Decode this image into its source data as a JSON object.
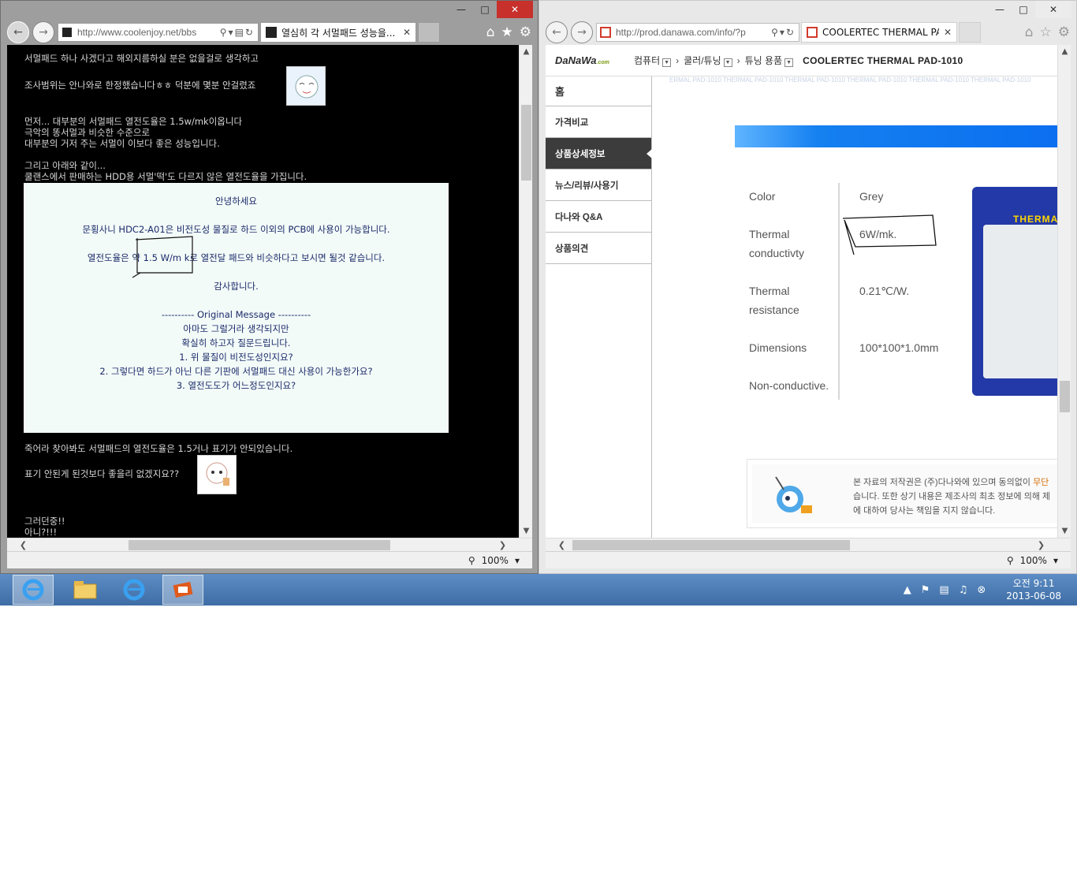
{
  "left_window": {
    "url": "http://www.coolenjoy.net/bbs",
    "tab_title": "열심히 각 서멀패드 성능을...",
    "zoom": "100%",
    "lines_top": [
      "서멀패드 하나 사겠다고 해외지름하실 분은 없을걸로 생각하고",
      "조사범위는 안나와로 한정했습니다ㅎㅎ 덕분에 몇분 안걸렸죠",
      "먼저... 대부분의 서멀패드 열전도율은 1.5w/mk이옵니다",
      "극악의 똥서멀과 비슷한 수준으로",
      "대부분의 거저 주는 서멀이 이보다 좋은 성능입니다.",
      "그리고 아래와 같이...",
      "쿨랜스에서 판매하는 HDD용 서멀'떡'도 다르지 않은 열전도율을 가집니다."
    ],
    "letter": [
      "안녕하세요",
      "문횡사니 HDC2-A01은 비전도성 물질로 하드 이외의 PCB에 사용이 가능합니다.",
      "열전도율은 약 1.5 W/m k로 열전달 패드와 비슷하다고 보시면 될것 같습니다.",
      "감사합니다.",
      "---------- Original Message ----------",
      "아마도 그럴거라 생각되지만",
      "확실히 하고자 질문드립니다.",
      "1. 위 물질이 비전도성인지요?",
      "2. 그렇다면 하드가 아닌 다른 기판에 서멀패드 대신 사용이 가능한가요?",
      "3. 열전도도가 어느정도인지요?"
    ],
    "lines_bottom": [
      "죽어라 찾아봐도 서멀패드의 열전도율은 1.5거나 표기가 안되있습니다.",
      "표기 안된게 된것보다 좋을리 없겠지요??",
      "그러던중!!",
      "아니?!!!"
    ]
  },
  "right_window": {
    "url": "http://prod.danawa.com/info/?p",
    "tab_title": "COOLERTEC THERMAL PA...",
    "zoom": "100%",
    "logo": "DaNaWa",
    "logo_suffix": ".com",
    "breadcrumbs": [
      "컴퓨터",
      "쿨러/튜닝",
      "튜닝 용품"
    ],
    "product_name": "COOLERTEC THERMAL PAD-1010",
    "side_menu": [
      "홈",
      "가격비교",
      "상품상세정보",
      "뉴스/리뷰/사용기",
      "다나와 Q&A",
      "상품의견"
    ],
    "active_menu_index": 2,
    "strip_text": "ERMAL PAD-1010  THERMAL PAD-1010  THERMAL PAD-1010  THERMAL PAD-1010  THERMAL PAD-1010  THERMAL PAD-1010",
    "specs": [
      {
        "label": "Color",
        "value": "Grey"
      },
      {
        "label": "Thermal conductivty",
        "value": "6W/mk."
      },
      {
        "label": "Thermal resistance",
        "value": "0.21℃/W."
      },
      {
        "label": "Dimensions",
        "value": "100*100*1.0mm"
      },
      {
        "label": "Non-conductive.",
        "value": ""
      }
    ],
    "pack_label": "THERMAL",
    "notice_line1_a": "본 자료의 저작권은 (주)다나와에 있으며 동의없이 ",
    "notice_line1_b": "무단",
    "notice_line2": "습니다. 또한 상기 내용은 제조사의 최초 정보에 의해 제",
    "notice_line3": "에 대하여 당사는 책임을 지지 않습니다."
  },
  "taskbar": {
    "clock_time": "오전 9:11",
    "clock_date": "2013-06-08"
  }
}
